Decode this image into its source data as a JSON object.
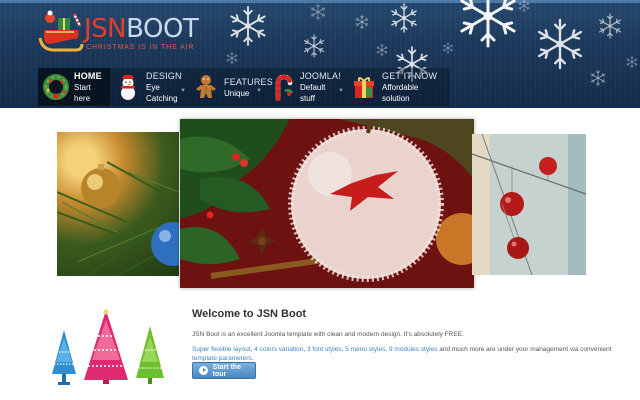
{
  "header": {
    "logo": {
      "brand_part1": "JSN",
      "brand_part2": "BOOT",
      "tagline": "CHRISTMAS IS IN THE AIR"
    }
  },
  "nav": {
    "items": [
      {
        "title": "HOME",
        "subtitle": "Start here",
        "icon": "wreath-icon",
        "active": true
      },
      {
        "title": "DESIGN",
        "subtitle": "Eye Catching",
        "icon": "snowman-icon",
        "active": false
      },
      {
        "title": "FEATURES",
        "subtitle": "Unique",
        "icon": "gingerbread-man-icon",
        "active": false
      },
      {
        "title": "JOOMLA!",
        "subtitle": "Default stuff",
        "icon": "candy-cane-icon",
        "active": false
      },
      {
        "title": "GET IT NOW",
        "subtitle": "Affordable solution",
        "icon": "gift-box-icon",
        "active": false
      }
    ]
  },
  "slideshow": {
    "slides": [
      {
        "icon": "christmas-tree-ornaments-photo"
      },
      {
        "icon": "frosted-apple-photo"
      },
      {
        "icon": "hanging-red-baubles-photo"
      }
    ]
  },
  "welcome": {
    "title": "Welcome to JSN Boot",
    "description": "JSN Boot is an excellent Joomla template with clean and modern design. It's absolutely FREE.",
    "features": {
      "link1": "Super flexible layout",
      "link2": "4 colors variation",
      "link3": "3 font styles",
      "link4": "5 menu styles",
      "link5": "9 modules styles",
      "suffix": " and much more are under your management via convenient ",
      "link6": "template parameters",
      "end": "."
    },
    "tour_button": "Start the tour"
  },
  "colors": {
    "header_bg": "#1b3759",
    "brand_red": "#e2402c",
    "link_blue": "#3c84c4",
    "button_blue": "#4a86bf"
  }
}
